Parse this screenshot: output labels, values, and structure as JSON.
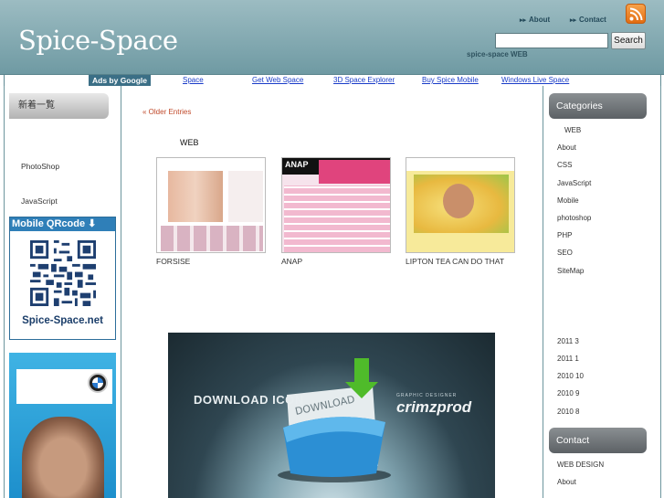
{
  "header": {
    "logo": "Spice-Space",
    "nav": [
      "About",
      "Contact"
    ],
    "search_placeholder": "",
    "search_button": "Search",
    "tagline": "spice-space WEB"
  },
  "adbar": {
    "ads_label": "Ads by Google",
    "links": [
      "Space",
      "Get Web Space",
      "3D Space Explorer",
      "Buy Spice Mobile",
      "Windows Live Space"
    ]
  },
  "left_sidebar": {
    "heading": "新着一覧",
    "links": [
      "PhotoShop",
      "JavaScript"
    ],
    "qr_title": "Mobile QRcode",
    "qr_caption": "Spice-Space.net"
  },
  "main": {
    "older_entries": "« Older Entries",
    "category": "WEB",
    "thumbs": [
      {
        "caption": "FORSISE"
      },
      {
        "caption": "ANAP",
        "inner_text": "ANAP"
      },
      {
        "caption": "LIPTON TEA CAN DO THAT"
      }
    ],
    "banner": {
      "title": "DOWNLOAD ICON",
      "label": "DOWNLOAD",
      "subtitle": "GRAPHIC DESIGNER",
      "brand": "crimzprod"
    }
  },
  "right_sidebar": {
    "categories_heading": "Categories",
    "categories": [
      "WEB",
      "About",
      "CSS",
      "JavaScript",
      "Mobile",
      "photoshop",
      "PHP",
      "SEO",
      "SiteMap"
    ],
    "archives": [
      "2011 3",
      "2011 1",
      "2010 10",
      "2010 9",
      "2010 8"
    ],
    "contact_heading": "Contact",
    "contact_links": [
      "WEB DESIGN",
      "About"
    ]
  },
  "colors": {
    "header_top": "#9cbcc2",
    "header_bottom": "#6f9aa3",
    "link_blue": "#1a3cc8",
    "older_link": "#c0492a",
    "rss_orange": "#e26d12"
  },
  "icons": [
    "rss-icon",
    "arrow-icon",
    "qr-code-icon",
    "download-arrow-icon"
  ]
}
